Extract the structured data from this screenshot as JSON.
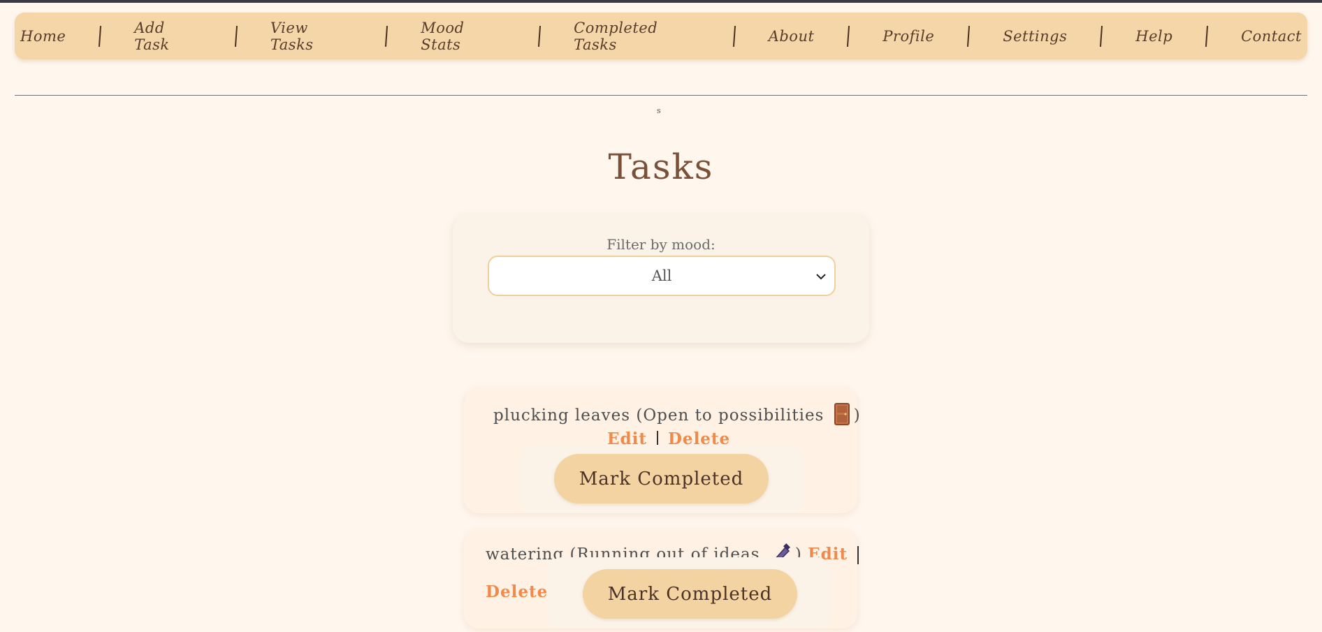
{
  "nav": {
    "items": [
      {
        "label": "Home"
      },
      {
        "label": "Add Task"
      },
      {
        "label": "View Tasks"
      },
      {
        "label": "Mood Stats"
      },
      {
        "label": "Completed Tasks"
      },
      {
        "label": "About"
      },
      {
        "label": "Profile"
      },
      {
        "label": "Settings"
      },
      {
        "label": "Help"
      },
      {
        "label": "Contact"
      }
    ]
  },
  "misc": {
    "tiny_text": "s"
  },
  "page": {
    "title": "Tasks"
  },
  "filter": {
    "label": "Filter by mood:",
    "selected": "All"
  },
  "tasks": [
    {
      "name": "plucking leaves",
      "mood": "Open to possibilities",
      "mood_icon": "door-icon",
      "edit_label": "Edit",
      "delete_label": "Delete",
      "complete_label": "Mark Completed"
    },
    {
      "name": "watering",
      "mood": "Running out of ideas",
      "mood_icon": "pen-icon",
      "edit_label": "Edit",
      "delete_label": "Delete",
      "complete_label": "Mark Completed"
    }
  ],
  "colors": {
    "background": "#fff6ee",
    "nav": "#f5d6a8",
    "button": "#f4d3a2",
    "link": "#f08a4b"
  }
}
